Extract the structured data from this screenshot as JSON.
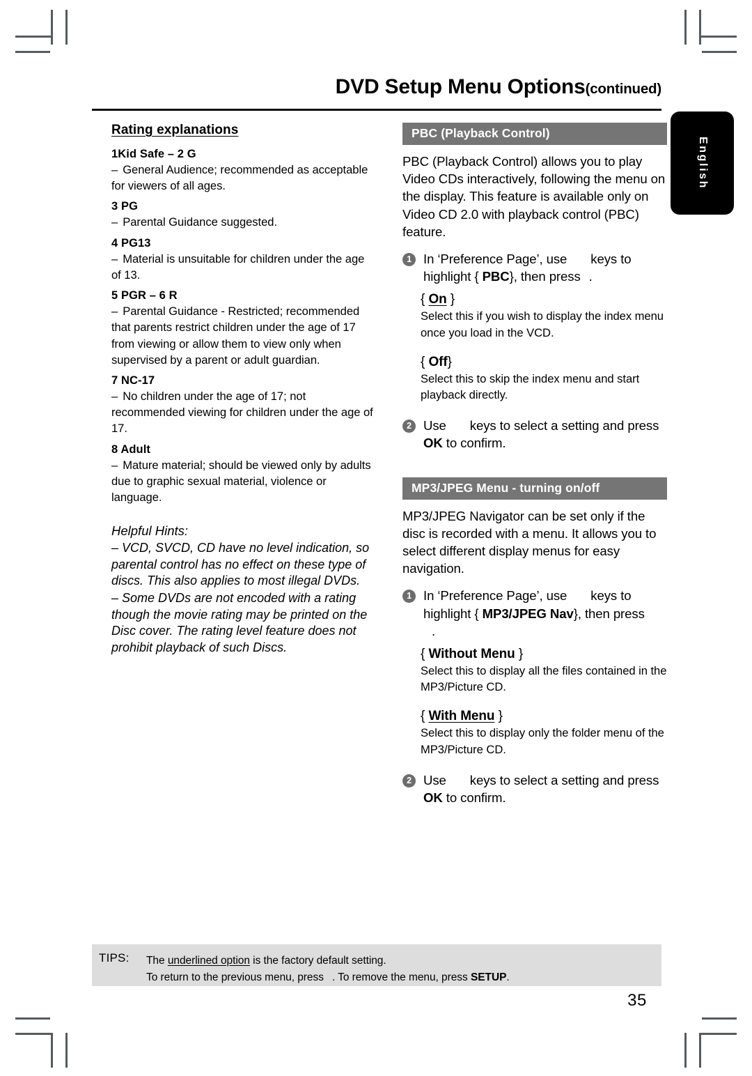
{
  "page": {
    "title_main": "DVD Setup Menu Options",
    "title_suffix": "(continued)",
    "language_tab": "English",
    "page_number": "35"
  },
  "left_column": {
    "heading": "Rating explanations",
    "ratings": [
      {
        "term": "1Kid Safe – 2 G",
        "dash": "–",
        "desc": "General Audience; recommended as acceptable for viewers of all ages."
      },
      {
        "term": "3 PG",
        "dash": "–",
        "desc": "Parental Guidance suggested."
      },
      {
        "term": "4 PG13",
        "dash": "–",
        "desc": "Material is unsuitable for children under the age of 13."
      },
      {
        "term": "5 PGR – 6 R",
        "dash": "–",
        "desc": "Parental Guidance - Restricted; recommended that parents restrict children under the age of 17 from viewing or allow them to view only when supervised by a parent or adult guardian."
      },
      {
        "term": "7 NC-17",
        "dash": "–",
        "desc": "No children under the age of 17; not recommended viewing for children under the age of 17."
      },
      {
        "term": "8  Adult",
        "dash": "–",
        "desc": "Mature material; should be viewed only by adults due to graphic sexual material, violence or language."
      }
    ],
    "hints_heading": "Helpful Hints:",
    "hints": [
      "– VCD, SVCD, CD have no level indication, so parental control has no effect on these type of discs. This also applies to most illegal DVDs.",
      "– Some DVDs are not encoded with a rating though the movie rating may be printed on the Disc cover. The rating level feature does not prohibit playback of such Discs."
    ]
  },
  "right_column": {
    "pbc": {
      "bar_title": "PBC (Playback Control)",
      "intro": "PBC (Playback Control) allows you to play Video CDs interactively, following the menu on the display. This feature is available only on Video CD 2.0 with playback control (PBC) feature.",
      "step1_num": "1",
      "step1_part1": "In ‘Preference Page’, use",
      "step1_part2": "keys to highlight {",
      "step1_bold": "PBC",
      "step1_part3": "}, then press",
      "step1_end": ".",
      "options": [
        {
          "brace_open": "{",
          "label": "On",
          "brace_close": "}",
          "underlined": true,
          "desc": "Select this if you wish to display the index menu once you load in the VCD."
        },
        {
          "brace_open": "{",
          "label": "Off",
          "brace_close": "}",
          "underlined": false,
          "desc": "Select this to skip the index menu and start playback directly."
        }
      ],
      "step2_num": "2",
      "step2_part1": "Use",
      "step2_part2": "keys to select a setting and press",
      "step2_bold": "OK",
      "step2_part3": "to confirm."
    },
    "mp3jpeg": {
      "bar_title": "MP3/JPEG Menu - turning on/off",
      "intro": "MP3/JPEG Navigator can be set only if the disc is recorded with a menu.  It allows you to select different display menus for easy navigation.",
      "step1_num": "1",
      "step1_part1": "In ‘Preference Page’, use",
      "step1_part2": "keys to highlight {",
      "step1_bold": "MP3/JPEG Nav",
      "step1_part3": "}, then press",
      "step1_end": ".",
      "options": [
        {
          "brace_open": "{",
          "label": "Without Menu",
          "brace_close": "}",
          "underlined": false,
          "desc": "Select this to display all the files contained in the MP3/Picture CD."
        },
        {
          "brace_open": "{",
          "label": "With Menu",
          "brace_close": "}",
          "underlined": true,
          "desc": "Select this to display only the folder menu of the MP3/Picture CD."
        }
      ],
      "step2_num": "2",
      "step2_part1": "Use",
      "step2_part2": "keys to select a setting and press",
      "step2_bold": "OK",
      "step2_part3": "to confirm."
    }
  },
  "tips": {
    "label": "TIPS:",
    "line1_pre": "The ",
    "line1_underlined": "underlined option",
    "line1_post": " is the factory default setting.",
    "line2_pre": "To return to the previous menu, press",
    "line2_mid": ". To remove the menu, press ",
    "line2_bold": "SETUP",
    "line2_end": "."
  }
}
